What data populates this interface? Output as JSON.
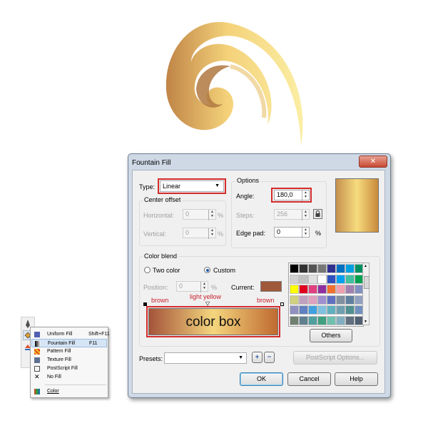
{
  "artwork": {
    "name": "golden swirl"
  },
  "flyout": {
    "items": [
      {
        "label": "Uniform Fill",
        "shortcut": "Shift+F11",
        "icon": "uniform-fill-icon"
      },
      {
        "label": "Fountain Fill",
        "shortcut": "F11",
        "icon": "fountain-fill-icon"
      },
      {
        "label": "Pattern Fill",
        "shortcut": "",
        "icon": "pattern-fill-icon"
      },
      {
        "label": "Texture Fill",
        "shortcut": "",
        "icon": "texture-fill-icon"
      },
      {
        "label": "PostScript Fill",
        "shortcut": "",
        "icon": "postscript-fill-icon"
      },
      {
        "label": "No Fill",
        "shortcut": "",
        "icon": "no-fill-icon"
      },
      {
        "label": "Color",
        "shortcut": "",
        "icon": "color-icon"
      }
    ]
  },
  "dialog": {
    "title": "Fountain Fill",
    "close": "✕",
    "type_label": "Type:",
    "type_value": "Linear",
    "center_offset": {
      "title": "Center offset",
      "horizontal_label": "Horizontal:",
      "horizontal_value": "0",
      "vertical_label": "Vertical:",
      "vertical_value": "0",
      "unit": "%"
    },
    "options": {
      "title": "Options",
      "angle_label": "Angle:",
      "angle_value": "180,0",
      "steps_label": "Steps:",
      "steps_value": "256",
      "edge_label": "Edge pad:",
      "edge_value": "0",
      "unit": "%"
    },
    "color_blend": {
      "title": "Color blend",
      "two_color": "Two color",
      "custom": "Custom",
      "position_label": "Position:",
      "position_value": "0",
      "unit": "%",
      "current_label": "Current:",
      "current_color": "#a0583a"
    },
    "annotations": {
      "left": "brown",
      "middle": "light yellow",
      "right": "brown",
      "box": "color box"
    },
    "palette_colors": [
      "#000000",
      "#333333",
      "#555555",
      "#777777",
      "#303090",
      "#0070c0",
      "#00a0e0",
      "#009060",
      "#d0d0d0",
      "#c0c0c0",
      "#e0e0e0",
      "#ffffff",
      "#3050c0",
      "#00a0f0",
      "#40c0a0",
      "#00a050",
      "#ffff00",
      "#e00020",
      "#e04080",
      "#9030a0",
      "#f07030",
      "#f0a0b0",
      "#a080b0",
      "#8090c0",
      "#d0d080",
      "#c0a0c0",
      "#e0a0c0",
      "#a090d0",
      "#6070c0",
      "#8090a0",
      "#6080a0",
      "#90a0c0",
      "#9090c0",
      "#6080c0",
      "#40a0e0",
      "#80c0e0",
      "#60b0c0",
      "#70a0b0",
      "#509090",
      "#7090c0",
      "#708070",
      "#608090",
      "#50a0a0",
      "#40a080",
      "#70c0b0",
      "#80b0c0",
      "#607080",
      "#506070"
    ],
    "others_label": "Others",
    "presets_label": "Presets:",
    "presets_add": "+",
    "presets_remove": "−",
    "postscript_label": "PostScript Options...",
    "ok_label": "OK",
    "cancel_label": "Cancel",
    "help_label": "Help",
    "lock_icon": "lock-icon",
    "gradient_colors": [
      "#c5914f",
      "#f6dc7e",
      "#c98a3c"
    ]
  }
}
